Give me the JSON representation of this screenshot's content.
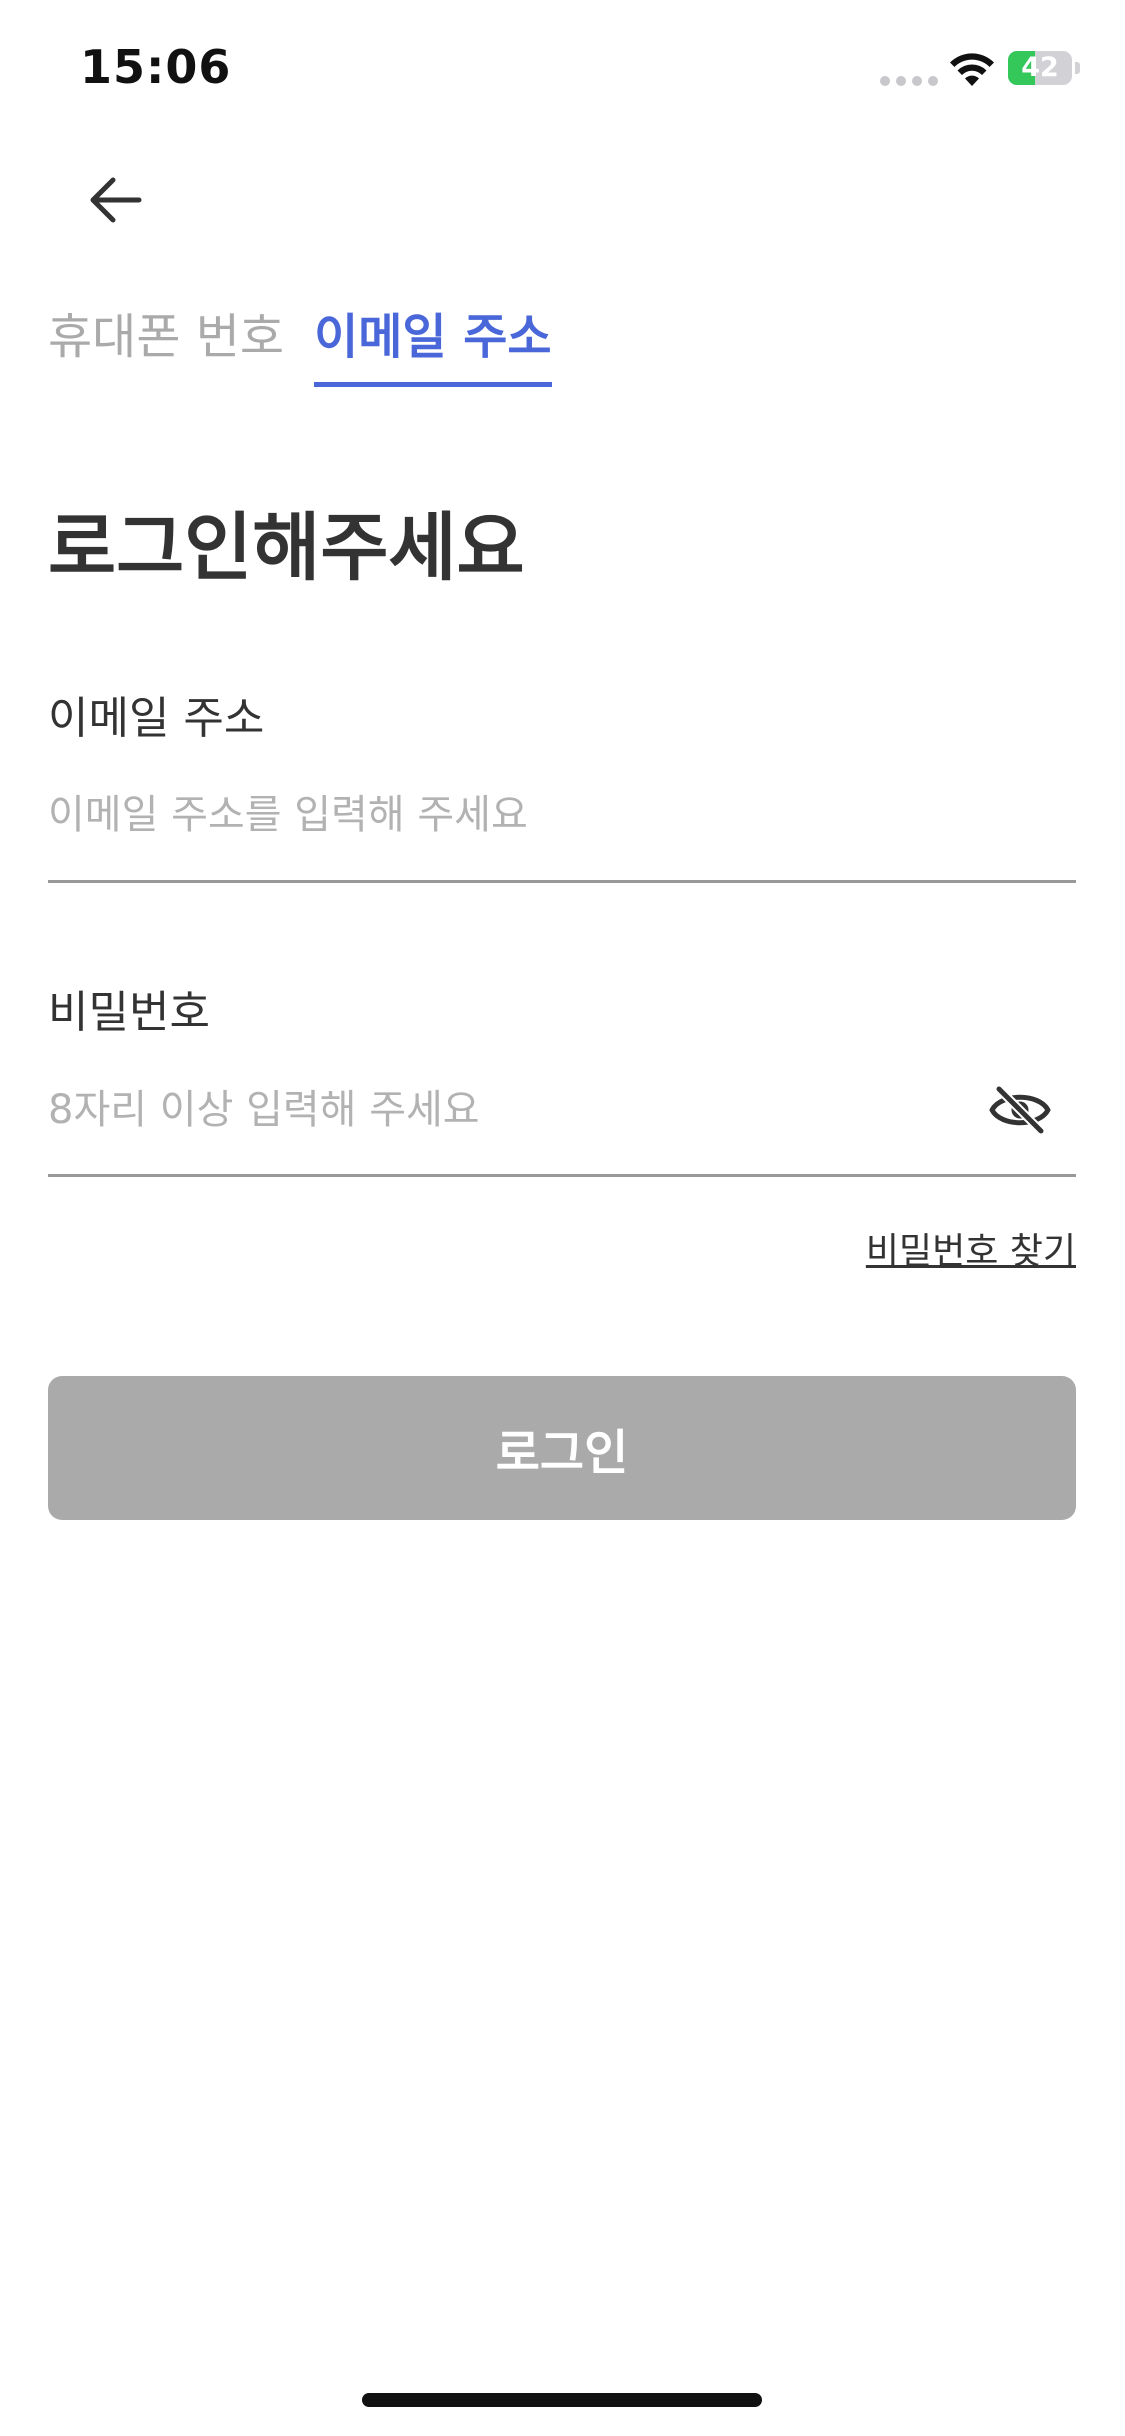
{
  "status_bar": {
    "time": "15:06",
    "battery_level": "42",
    "battery_fraction": 0.42,
    "battery_color": "#34c759"
  },
  "icons": {
    "back": "arrow-left-icon",
    "wifi": "wifi-icon",
    "password_visibility": "eye-off-icon"
  },
  "tabs": [
    {
      "label": "휴대폰 번호",
      "active": false
    },
    {
      "label": "이메일 주소",
      "active": true
    }
  ],
  "page_title": "로그인해주세요",
  "email_field": {
    "label": "이메일 주소",
    "placeholder": "이메일 주소를 입력해 주세요",
    "value": ""
  },
  "password_field": {
    "label": "비밀번호",
    "placeholder": "8자리 이상 입력해 주세요",
    "value": ""
  },
  "find_password_label": "비밀번호 찾기",
  "login_button": {
    "label": "로그인",
    "enabled": false
  },
  "colors": {
    "accent": "#4a67d9",
    "button_disabled": "#aaaaaa",
    "text_primary": "#333333",
    "placeholder": "#b2b2b2"
  }
}
